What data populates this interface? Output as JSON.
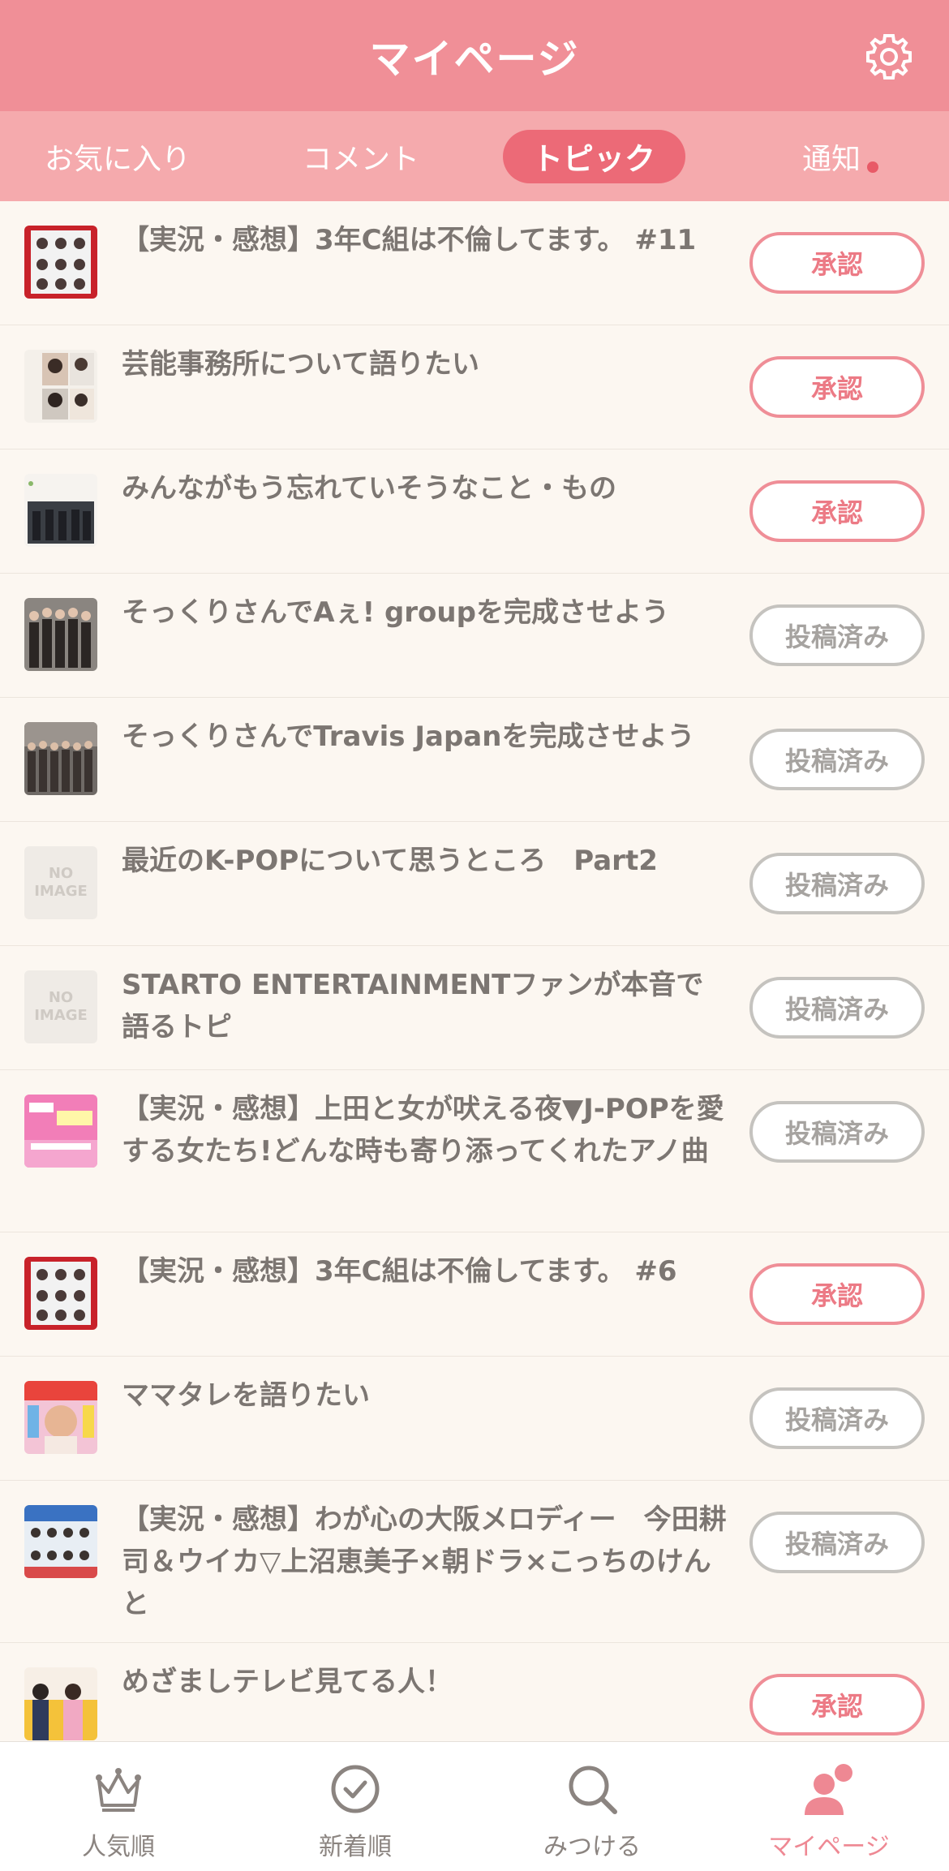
{
  "header": {
    "title": "マイページ"
  },
  "tabs": [
    {
      "label": "お気に入り"
    },
    {
      "label": "コメント"
    },
    {
      "label": "トピック"
    },
    {
      "label": "通知"
    }
  ],
  "topics": [
    {
      "title": "【実況・感想】3年C組は不倫してます。 #11",
      "status": "承認"
    },
    {
      "title": "芸能事務所について語りたい",
      "status": "承認"
    },
    {
      "title": "みんながもう忘れていそうなこと・もの",
      "status": "承認"
    },
    {
      "title": "そっくりさんでAぇ! groupを完成させよう",
      "status": "投稿済み"
    },
    {
      "title": "そっくりさんでTravis Japanを完成させよう",
      "status": "投稿済み"
    },
    {
      "title": "最近のK-POPについて思うところ　Part2",
      "status": "投稿済み"
    },
    {
      "title": "STARTO ENTERTAINMENTファンが本音で語るトピ",
      "status": "投稿済み"
    },
    {
      "title": "【実況・感想】上田と女が吠える夜▼J-POPを愛する女たち!どんな時も寄り添ってくれたアノ曲",
      "status": "投稿済み"
    },
    {
      "title": "【実況・感想】3年C組は不倫してます。 #6",
      "status": "承認"
    },
    {
      "title": "ママタレを語りたい",
      "status": "投稿済み"
    },
    {
      "title": "【実況・感想】わが心の大阪メロディー　今田耕司＆ウイカ▽上沼恵美子×朝ドラ×こっちのけんと",
      "status": "投稿済み"
    },
    {
      "title": "めざましテレビ見てる人！",
      "status": "承認"
    }
  ],
  "no_image": {
    "line1": "NO",
    "line2": "IMAGE"
  },
  "bottom_nav": [
    {
      "label": "人気順",
      "icon": "crown-icon"
    },
    {
      "label": "新着順",
      "icon": "clock-icon"
    },
    {
      "label": "みつける",
      "icon": "search-icon"
    },
    {
      "label": "マイページ",
      "icon": "users-icon"
    }
  ],
  "colors": {
    "header": "#f08f97",
    "tabs": "#f5aaad",
    "active_tab": "#ec6a77",
    "approve": "#ef8e97",
    "posted": "#c5c3bf"
  }
}
